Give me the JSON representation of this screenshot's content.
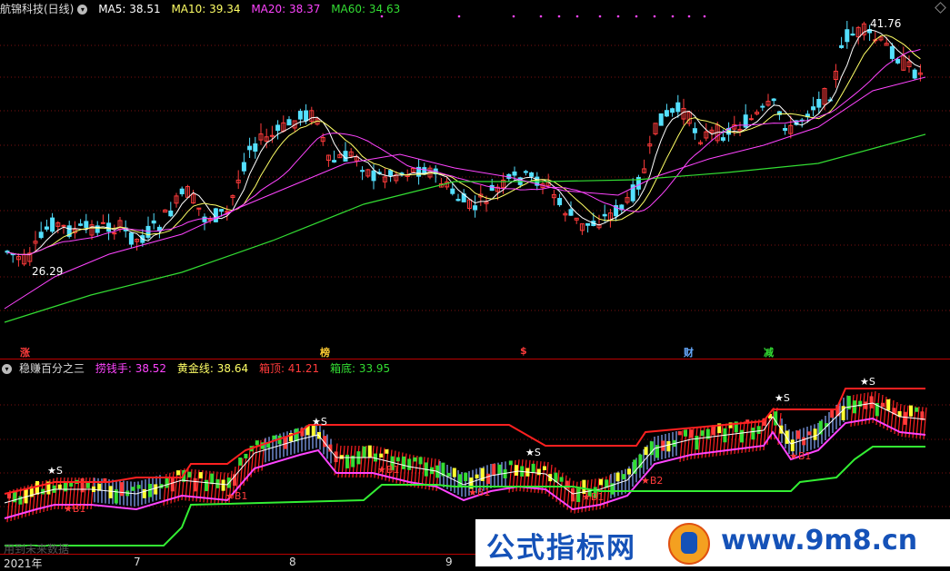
{
  "main": {
    "title": "航锦科技(日线)",
    "ma5": "MA5: 38.51",
    "ma10": "MA10: 39.34",
    "ma20": "MA20: 38.37",
    "ma60": "MA60: 34.63",
    "high_label": "41.76",
    "low_label": "26.29",
    "colors": {
      "ma5": "#ffffff",
      "ma10": "#ffff66",
      "ma20": "#ff44ff",
      "ma60": "#33dd33",
      "up": "#ff3b3b",
      "down": "#54e0ff"
    }
  },
  "event_tags": [
    {
      "text": "涨",
      "color": "#ff3b3b"
    },
    {
      "text": "榜",
      "color": "#ffcc33"
    },
    {
      "text": "$",
      "color": "#ff3b3b"
    },
    {
      "text": "财",
      "color": "#66aaff"
    },
    {
      "text": "减",
      "color": "#33dd33"
    }
  ],
  "sub": {
    "title": "稳赚百分之三",
    "laoqian": "捞钱手: 38.52",
    "huangjin": "黄金线: 38.64",
    "xiangding": "箱顶: 41.21",
    "xiangdi": "箱底: 33.95",
    "signals": [
      "★S",
      "★S",
      "★S",
      "★S",
      "★S",
      "★B1",
      "★B1",
      "★B1",
      "★B1",
      "★B1",
      "★B2",
      "★B1"
    ],
    "note": "用到未来数据"
  },
  "xaxis": {
    "labels": [
      "2021年",
      "7",
      "8",
      "9"
    ]
  },
  "watermark": {
    "left": "公式指标网",
    "right": "www.9m8.cn"
  }
}
